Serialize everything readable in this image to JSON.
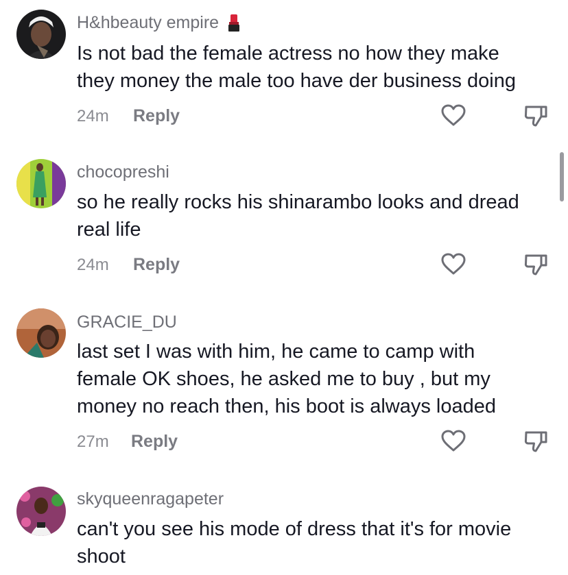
{
  "comments": [
    {
      "username": "H&hbeauty empire",
      "emoji": "lipstick",
      "lines": [
        "Is not bad the female actress no how they make",
        "they money the male too have der business doing"
      ],
      "time": "24m",
      "reply_label": "Reply"
    },
    {
      "username": "chocopreshi",
      "lines": [
        "so he really rocks his shinarambo looks and dread",
        "real life"
      ],
      "time": "24m",
      "reply_label": "Reply"
    },
    {
      "username": "GRACIE_DU",
      "lines": [
        "last set I was with him, he came to camp with",
        "female OK shoes, he asked me to buy , but my",
        "money no reach then, his boot is always loaded"
      ],
      "time": "27m",
      "reply_label": "Reply"
    },
    {
      "username": "skyqueenragapeter",
      "lines": [
        "can't you see his mode of dress that it's for movie",
        "shoot"
      ]
    }
  ],
  "icons": {
    "like": "heart-icon",
    "dislike": "thumbs-down-icon"
  },
  "colors": {
    "username": "#6e6f76",
    "text": "#161823",
    "meta": "#8a8b91",
    "icon": "#6d6e75"
  }
}
